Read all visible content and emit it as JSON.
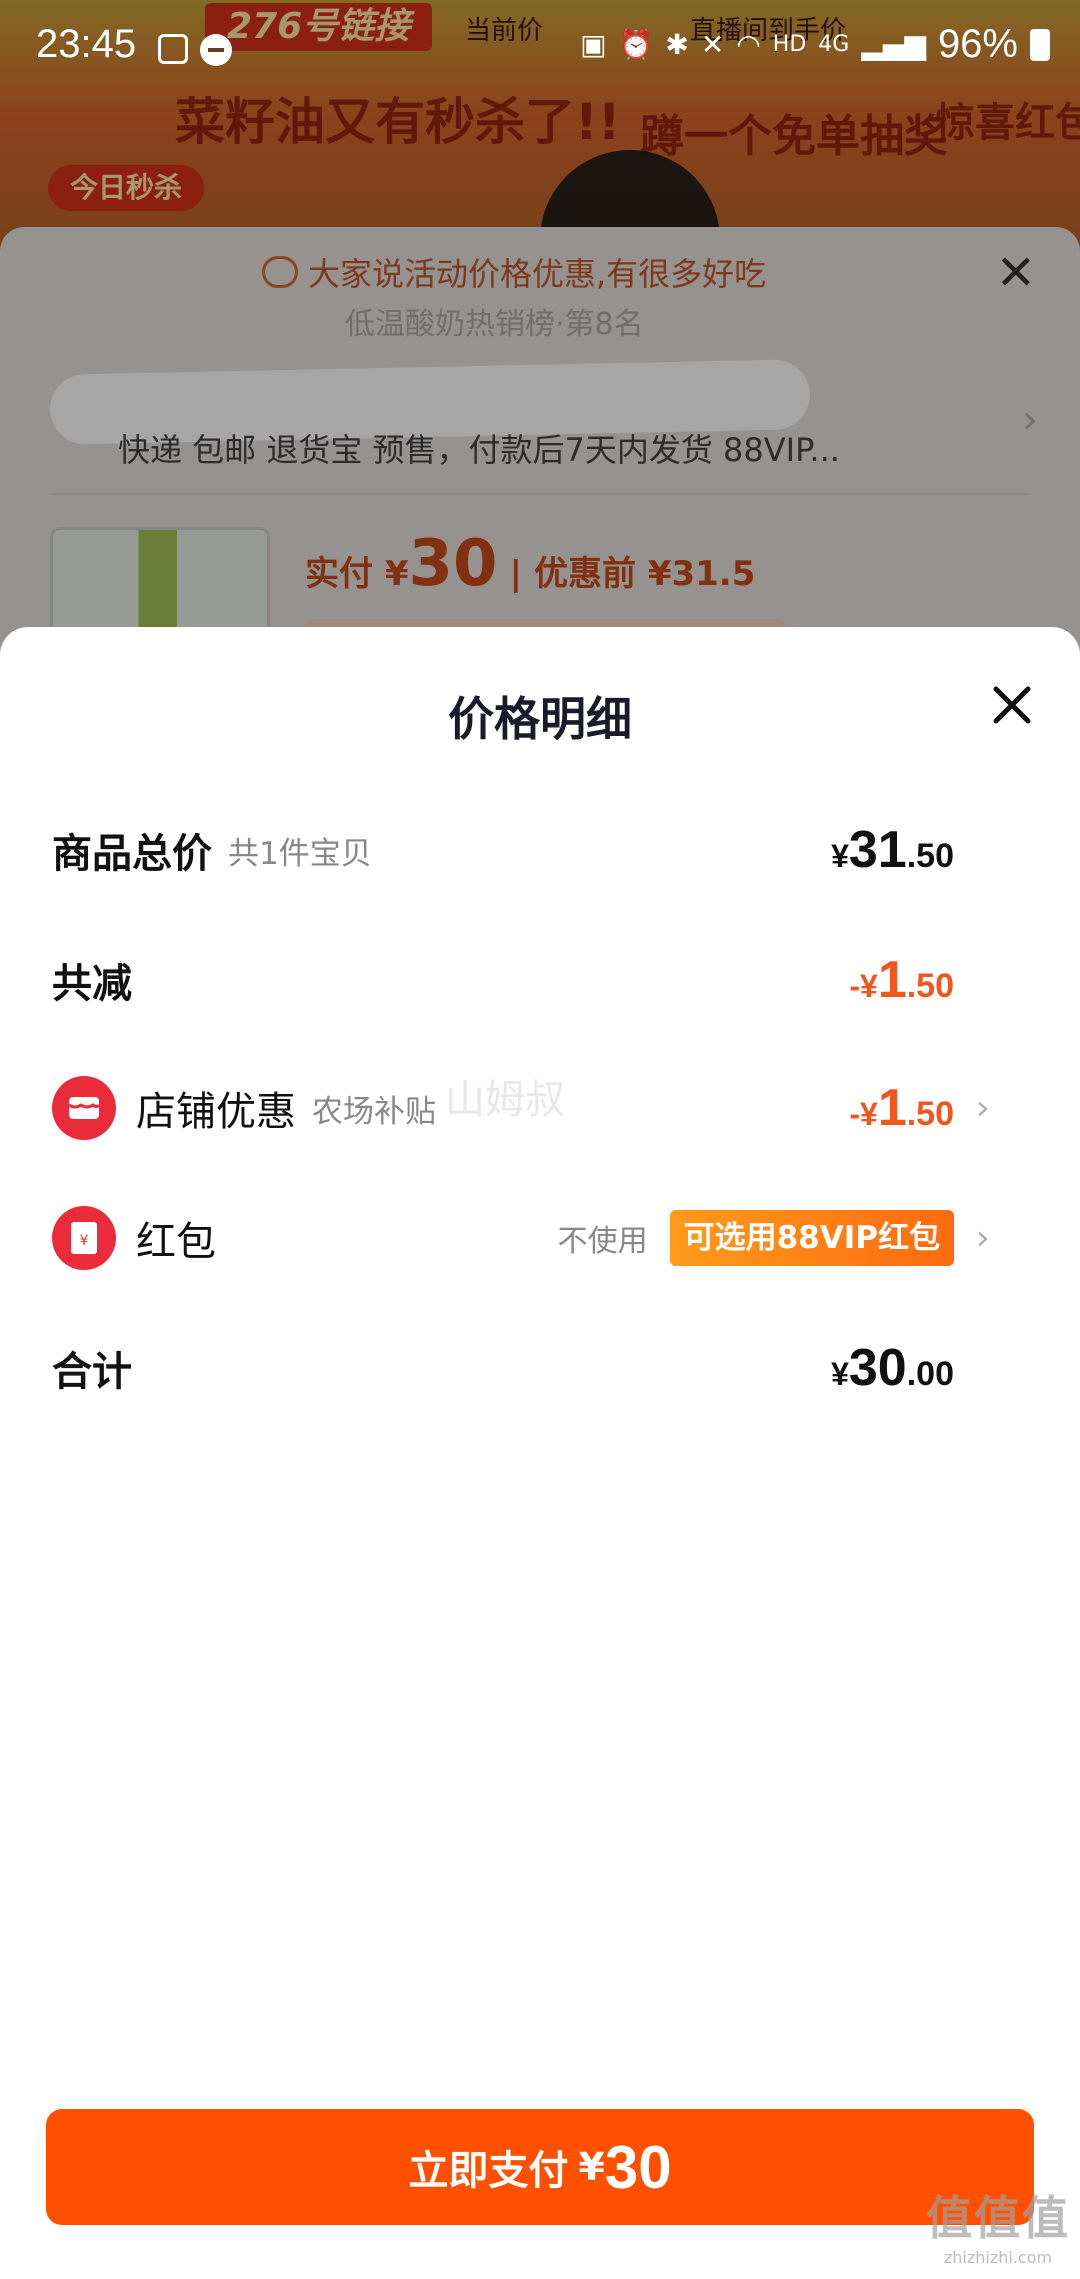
{
  "status_bar": {
    "time": "23:45",
    "hd": "HD",
    "net": "4G",
    "battery": "96%"
  },
  "background": {
    "link_tag": "276号链接",
    "current_price_label": "当前价",
    "back_to_price_label": "直播间到手价",
    "today_flash": "今日秒杀",
    "banner_1": "菜籽油又有秒杀了!!",
    "banner_2": "蹲一个免单抽奖",
    "banner_3": "惊喜红包"
  },
  "order_sheet": {
    "hint": "大家说活动价格优惠,有很多好吃",
    "hint_2": "低温酸奶热销榜·第8名",
    "services": "快递 包邮 退货宝 预售，付款后7天内发货 88VIP...",
    "pay_label": "实付 ¥",
    "pay_value": "30",
    "before_label": "优惠前 ¥31.5"
  },
  "detail": {
    "title": "价格明细",
    "total_label": "商品总价",
    "total_sub": "共1件宝贝",
    "total_yen": "¥",
    "total_int": "31",
    "total_dec": ".50",
    "reduce_label": "共减",
    "reduce_yen": "-¥",
    "reduce_int": "1",
    "reduce_dec": ".50",
    "shop_label": "店铺优惠",
    "shop_sub": "农场补贴",
    "shop_yen": "-¥",
    "shop_int": "1",
    "shop_dec": ".50",
    "hongbao_label": "红包",
    "hongbao_status": "不使用",
    "hongbao_tag": "可选用88VIP红包",
    "sum_label": "合计",
    "sum_yen": "¥",
    "sum_int": "30",
    "sum_dec": ".00",
    "watermark": "山姆叔"
  },
  "pay_button": {
    "label": "立即支付",
    "yen": "¥",
    "amount": "30"
  },
  "corner_watermark": {
    "logo": "值值值",
    "url": "zhizhizhi.com"
  },
  "colors": {
    "accent": "#ff5000",
    "discount": "#f2561c",
    "badge_red": "#ea2c3a"
  }
}
